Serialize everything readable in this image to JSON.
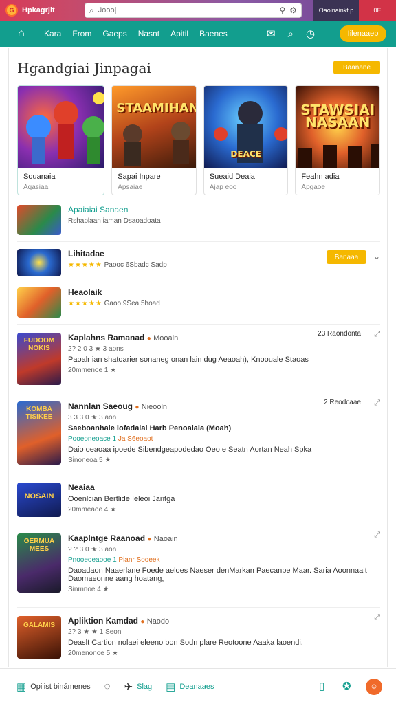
{
  "app": {
    "logo_letter": "G",
    "brand": "Hpkagrjit",
    "search_placeholder": "Jooo|",
    "account_btn": "Oaoinainkt p",
    "close_btn": "0E"
  },
  "nav": {
    "items": [
      "Kara",
      "From",
      "Gaeps",
      "Nasnt",
      "Apitil",
      "Baenes"
    ],
    "cta": "Iilenaaep"
  },
  "page": {
    "title": "Hgandgiai Jinpagai",
    "title_btn": "Baanane"
  },
  "featured": [
    {
      "title": "Souanaia",
      "sub": "Aqasiaa",
      "art": ""
    },
    {
      "title": "Sapai Inpare",
      "sub": "Apsaiae",
      "art": "STAAMIHAN"
    },
    {
      "title": "Sueaid Deaia",
      "sub": "Ajap eoo",
      "art": "DEACE"
    },
    {
      "title": "Feahn adia",
      "sub": "Apgaoe",
      "art": "STAWSIAI NASAAN"
    }
  ],
  "list": [
    {
      "type": "header",
      "title": "Apaiaiai Sanaen",
      "sub": "Rshaplaan iaman Dsaoadoata"
    },
    {
      "type": "rated",
      "title": "Lihitadae",
      "stars": "★★★★★",
      "meta": "Paooc 6Sbadc Sadp",
      "btn": "Banaaa"
    },
    {
      "type": "rated",
      "title": "Heaolaik",
      "stars": "★★★★★",
      "meta": "Gaoo 9Sea 5hoad"
    },
    {
      "type": "game",
      "title": "Kaplahns Ramanad",
      "dev": "Mooaln",
      "meta": "2? 2 0 3 ★ 3 aons",
      "desc": "Paoalr ian shatoarier sonaneg onan lain dug Aeaoah), Knoouale Staoas",
      "count": "20mmenoe 1 ★",
      "side": "23 Raondonta",
      "thumb_art": "FUDOOM NOKIS"
    },
    {
      "type": "game",
      "title": "Nannlan Saeoug",
      "dev": "Nieooln",
      "meta": "3 3 3 0 ★ 3 aon",
      "desc_bold": "Saeboanhaie lofadaial Harb Penoalaia (Moah)",
      "promo": "Pooeoneoace 1 ",
      "promo_hl": "Ja S6eoaot",
      "desc": "Daio oeaoaa ipoede Sibendgeapodedao Oeo e Seatn Aortan Neah Spka",
      "count": "Sinoneoa 5 ★",
      "side": "2 Reodcaae",
      "thumb_art": "KOMBA TISIKEE"
    },
    {
      "type": "game",
      "title": "Neaiaa",
      "meta": "",
      "desc": "Ooenlcian Bertlide Ieleoi Jaritga",
      "count": "20mmeaoe 4 ★",
      "thumb_art": "NOSAIN"
    },
    {
      "type": "game",
      "title": "Kaaplntge Raanoad",
      "dev": "Naoain",
      "meta": "? ? 3 0 ★ 3 aon",
      "promo": "Pnooeoeaooe 1 ",
      "promo_hl": "Pianr Sooeek",
      "desc": "Daoadaon Naaerlane Foede aeloes Naeser denMarkan Paecanpe Maar. Saria Aoonnaait Daomaeonne aang hoatang,",
      "count": "Sinmnoe 4 ★",
      "thumb_art": "GERMUA MEES"
    },
    {
      "type": "game",
      "title": "Apliktion Kamdad",
      "dev": "Naodo",
      "meta": "2? 3 ★ ★ 1 Seon",
      "desc": "Deaslt Cartion nolaei eleeno bon Sodn plare Reotoone Aaaka laoendi.",
      "count": "20menonoe 5 ★",
      "thumb_art": "GALAMIS"
    }
  ],
  "bottom": {
    "left": "Opilist binámenes",
    "mid": "Slag",
    "right": "Deanaaes"
  }
}
